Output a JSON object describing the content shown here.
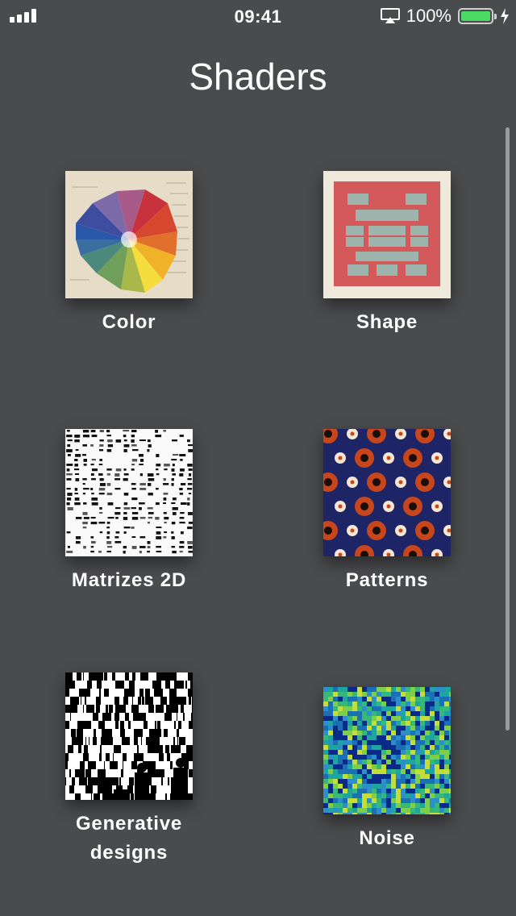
{
  "status_bar": {
    "time": "09:41",
    "battery_percent": "100%",
    "battery_level": 1.0,
    "signal_bars": 4,
    "airplay_icon": "airplay-icon",
    "charging_icon": "bolt-icon",
    "battery_color": "#4cd964"
  },
  "page": {
    "title": "Shaders"
  },
  "grid": {
    "items": [
      {
        "label": "Color",
        "image": "color-wheel-image"
      },
      {
        "label": "Shape",
        "image": "shape-pattern-image"
      },
      {
        "label": "Matrizes 2D",
        "image": "matrix-glyphs-image"
      },
      {
        "label": "Patterns",
        "image": "circle-pattern-image"
      },
      {
        "label_line1": "Generative",
        "label_line2": "designs",
        "image": "generative-barcode-image"
      },
      {
        "label": "Noise",
        "image": "noise-map-image"
      }
    ]
  },
  "colors": {
    "background": "#4a4b4d",
    "text": "#ffffff"
  }
}
